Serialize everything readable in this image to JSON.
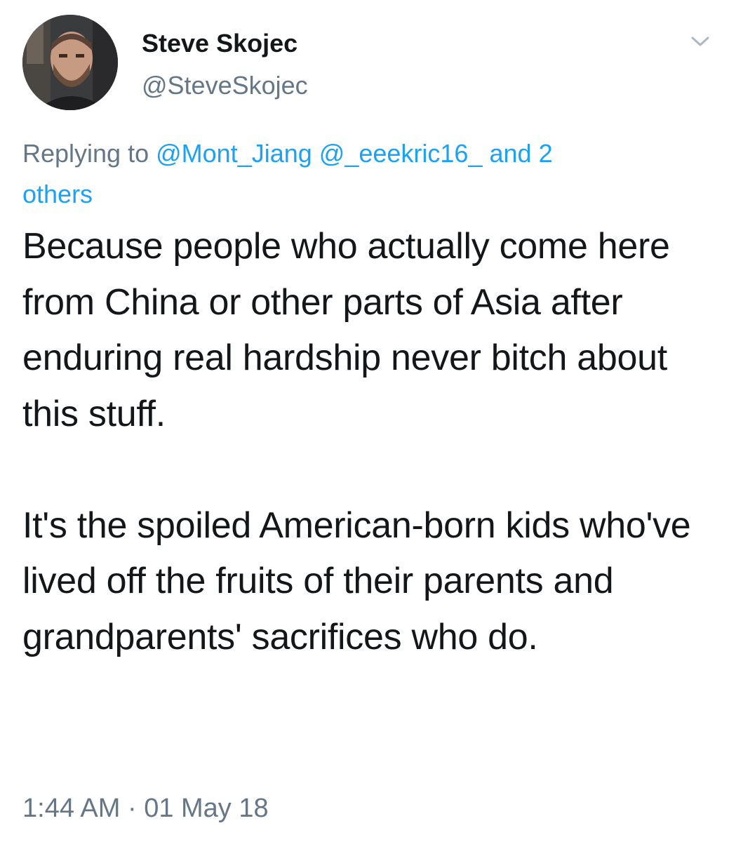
{
  "author": {
    "display_name": "Steve Skojec",
    "handle": "@SteveSkojec",
    "avatar_icon": "user-avatar-photo"
  },
  "menu": {
    "icon": "chevron-down-icon"
  },
  "reply_context": {
    "prefix": "Replying to ",
    "mention_1": "@Mont_Jiang",
    "mention_2": "@_eeekric16_",
    "connector": "and 2",
    "others": "others"
  },
  "tweet": {
    "paragraph_1": "Because people who actually come here from China or other parts of Asia after enduring real hardship never bitch about this stuff.",
    "paragraph_2": "It's the spoiled American-born kids who've lived off the fruits of their parents and grandparents' sacrifices who do.",
    "timestamp": "1:44 AM · 01 May 18"
  },
  "colors": {
    "text": "#14171a",
    "secondary": "#657786",
    "link": "#1da1f2",
    "background": "#ffffff"
  }
}
